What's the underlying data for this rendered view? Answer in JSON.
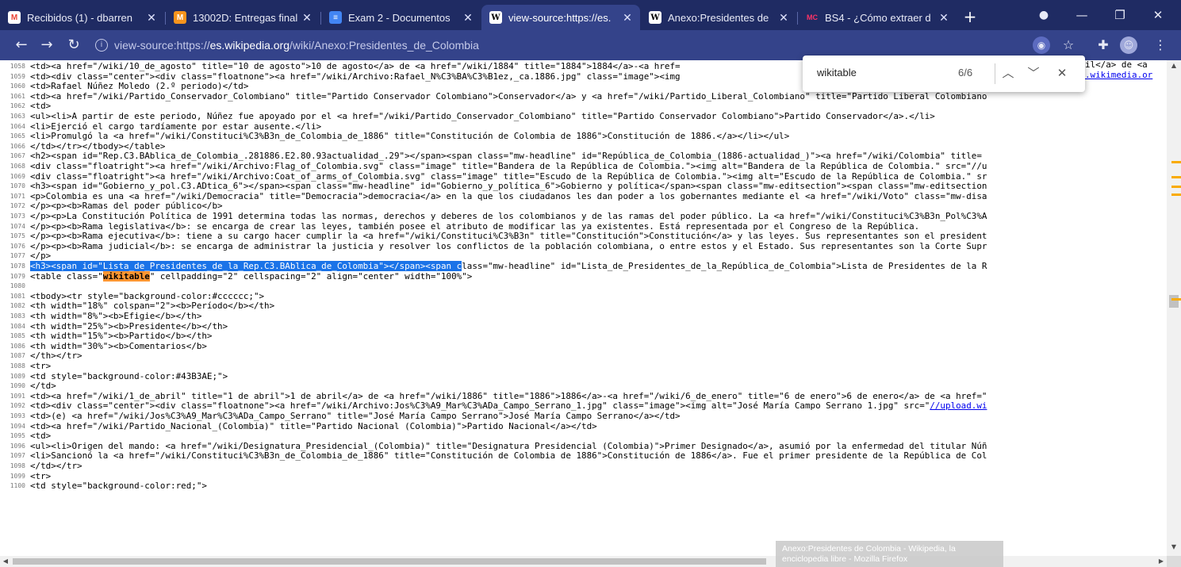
{
  "tabs": [
    {
      "title": "Recibidos (1) - dbarren",
      "icon": "gmail-icon",
      "active": false
    },
    {
      "title": "13002D: Entregas final",
      "icon": "moodle-icon",
      "active": false
    },
    {
      "title": "Exam 2 - Documentos",
      "icon": "docs-icon",
      "active": false
    },
    {
      "title": "view-source:https://es.",
      "icon": "wikipedia-icon",
      "active": true
    },
    {
      "title": "Anexo:Presidentes de",
      "icon": "wikipedia-icon",
      "active": false
    },
    {
      "title": "BS4 - ¿Cómo extraer d",
      "icon": "mc-icon",
      "active": false
    }
  ],
  "address_bar": {
    "prefix": "view-source:https://",
    "domain": "es.wikipedia.org",
    "path": "/wiki/Anexo:Presidentes_de_Colombia"
  },
  "find_bar": {
    "query": "wikitable",
    "count": "6/6"
  },
  "hover_tooltip": {
    "line1": "Anexo:Presidentes de Colombia - Wikipedia, la",
    "line2": "enciclopedia libre - Mozilla Firefox"
  },
  "source_lines": [
    {
      "num": "1058",
      "text": "<td><a href=\"/wiki/10_de_agosto\" title=\"10 de agosto\">10 de agosto</a> de <a href=\"/wiki/1884\" title=\"1884\">1884</a>-<a href="
    },
    {
      "num": "1059",
      "text": "<td><div class=\"center\"><div class=\"floatnone\"><a href=\"/wiki/Archivo:Rafael_N%C3%BA%C3%B1ez,_ca.1886.jpg\" class=\"image\"><img"
    },
    {
      "num": "1060",
      "text": "<td>Rafael Núñez Moledo (2.º periodo)</td>"
    },
    {
      "num": "1061",
      "text": "<td><a href=\"/wiki/Partido_Conservador_Colombiano\" title=\"Partido Conservador Colombiano\">Conservador</a> y <a href=\"/wiki/Partido_Liberal_Colombiano\" title=\"Partido Liberal Colombiano"
    },
    {
      "num": "1062",
      "text": "<td>"
    },
    {
      "num": "1063",
      "text": "<ul><li>A partir de este periodo, Núñez fue apoyado por el <a href=\"/wiki/Partido_Conservador_Colombiano\" title=\"Partido Conservador Colombiano\">Partido Conservador</a>.</li>"
    },
    {
      "num": "1064",
      "text": "<li>Ejerció el cargo tardíamente por estar ausente.</li>"
    },
    {
      "num": "1065",
      "text": "<li>Promulgó la <a href=\"/wiki/Constituci%C3%B3n_de_Colombia_de_1886\" title=\"Constitución de Colombia de 1886\">Constitución de 1886.</a></li></ul>"
    },
    {
      "num": "1066",
      "text": "</td></tr></tbody></table>"
    },
    {
      "num": "1067",
      "text": "<h2><span id=\"Rep.C3.BAblica_de_Colombia_.281886.E2.80.93actualidad_.29\"></span><span class=\"mw-headline\" id=\"República_de_Colombia_(1886-actualidad_)\"><a href=\"/wiki/Colombia\" title="
    },
    {
      "num": "1068",
      "text": "<div class=\"floatright\"><a href=\"/wiki/Archivo:Flag_of_Colombia.svg\" class=\"image\" title=\"Bandera de la República de Colombia.\"><img alt=\"Bandera de la República de Colombia.\" src=\"//u"
    },
    {
      "num": "1069",
      "text": "<div class=\"floatright\"><a href=\"/wiki/Archivo:Coat_of_arms_of_Colombia.svg\" class=\"image\" title=\"Escudo de la República de Colombia.\"><img alt=\"Escudo de la República de Colombia.\" sr"
    },
    {
      "num": "1070",
      "text": "<h3><span id=\"Gobierno_y_pol.C3.ADtica_6\"></span><span class=\"mw-headline\" id=\"Gobierno_y_política_6\">Gobierno y política</span><span class=\"mw-editsection\"><span class=\"mw-editsection"
    },
    {
      "num": "1071",
      "text": "<p>Colombia es una <a href=\"/wiki/Democracia\" title=\"Democracia\">democracia</a> en la que los ciudadanos les dan poder a los gobernantes mediante el <a href=\"/wiki/Voto\" class=\"mw-disa"
    },
    {
      "num": "1072",
      "text": "</p><p><b>Ramas del poder público</b>"
    },
    {
      "num": "1073",
      "text": "</p><p>La Constitución Política de 1991 determina todas las normas, derechos y deberes de los colombianos y de las ramas del poder público. La <a href=\"/wiki/Constituci%C3%B3n_Pol%C3%A"
    },
    {
      "num": "1074",
      "text": "</p><p><b>Rama legislativa</b>: se encarga de crear las leyes, también posee el atributo de modificar las ya existentes. Está representada por el Congreso de la República."
    },
    {
      "num": "1075",
      "text": "</p><p><b>Rama ejecutiva</b>: tiene a su cargo hacer cumplir la <a href=\"/wiki/Constituci%C3%B3n\" title=\"Constitución\">Constitución</a> y las leyes. Sus representantes son el president"
    },
    {
      "num": "1076",
      "text": "</p><p><b>Rama judicial</b>: se encarga de administrar la justicia y resolver los conflictos de la población colombiana, o entre estos y el Estado. Sus representantes son la Corte Supr"
    },
    {
      "num": "1077",
      "text": "</p>"
    },
    {
      "num": "1078",
      "sel": "<h3><span id=\"Lista_de_Presidentes_de_la_Rep.C3.BAblica_de_Colombia\"></span><span c",
      "text": "lass=\"mw-headline\" id=\"Lista_de_Presidentes_de_la_República_de_Colombia\">Lista de Presidentes de la R"
    },
    {
      "num": "1079",
      "pre": "<table class=\"",
      "hl": "wikitable",
      "text": "\" cellpadding=\"2\" cellspacing=\"2\" align=\"center\" width=\"100%\">"
    },
    {
      "num": "1080",
      "text": ""
    },
    {
      "num": "1081",
      "text": "<tbody><tr style=\"background-color:#cccccc;\">"
    },
    {
      "num": "1082",
      "text": "<th width=\"18%\" colspan=\"2\"><b>Período</b></th>"
    },
    {
      "num": "1083",
      "text": "<th width=\"8%\"><b>Efigie</b></th>"
    },
    {
      "num": "1084",
      "text": "<th width=\"25%\"><b>Presidente</b></th>"
    },
    {
      "num": "1085",
      "text": "<th width=\"15%\"><b>Partido</b></th>"
    },
    {
      "num": "1086",
      "text": "<th width=\"30%\"><b>Comentarios</b>"
    },
    {
      "num": "1087",
      "text": "</th></tr>"
    },
    {
      "num": "1088",
      "text": "<tr>"
    },
    {
      "num": "1089",
      "text": "<td style=\"background-color:#43B3AE;\">"
    },
    {
      "num": "1090",
      "text": "</td>"
    },
    {
      "num": "1091",
      "text": "<td><a href=\"/wiki/1_de_abril\" title=\"1 de abril\">1 de abril</a> de <a href=\"/wiki/1886\" title=\"1886\">1886</a>-<a href=\"/wiki/6_de_enero\" title=\"6 de enero\">6 de enero</a> de <a href=\""
    },
    {
      "num": "1092",
      "pre": "<td><div class=\"center\"><div class=\"floatnone\"><a href=\"/wiki/Archivo:Jos%C3%A9_Mar%C3%ADa_Campo_Serrano_1.jpg\" class=\"image\"><img alt=\"José María Campo Serrano 1.jpg\" src=\"",
      "lnk": "//upload.wi",
      "text": ""
    },
    {
      "num": "1093",
      "text": "<td>(e) <a href=\"/wiki/Jos%C3%A9_Mar%C3%ADa_Campo_Serrano\" title=\"José María Campo Serrano\">José María Campo Serrano</a></td>"
    },
    {
      "num": "1094",
      "text": "<td><a href=\"/wiki/Partido_Nacional_(Colombia)\" title=\"Partido Nacional (Colombia)\">Partido Nacional</a></td>"
    },
    {
      "num": "1095",
      "text": "<td>"
    },
    {
      "num": "1096",
      "text": "<ul><li>Origen del mando: <a href=\"/wiki/Designatura_Presidencial_(Colombia)\" title=\"Designatura Presidencial (Colombia)\">Primer Designado</a>, asumió por la enfermedad del titular Núñ"
    },
    {
      "num": "1097",
      "text": "<li>Sancionó la <a href=\"/wiki/Constituci%C3%B3n_de_Colombia_de_1886\" title=\"Constitución de Colombia de 1886\">Constitución de 1886</a>. Fue el primer presidente de la República de Col"
    },
    {
      "num": "1098",
      "text": "</td></tr>"
    },
    {
      "num": "1099",
      "text": "<tr>"
    },
    {
      "num": "1100",
      "text": "<td style=\"background-color:red;\">"
    }
  ],
  "right_overflow": {
    "1058": "il</a> de <a",
    "1059": ".wikimedia.or"
  }
}
